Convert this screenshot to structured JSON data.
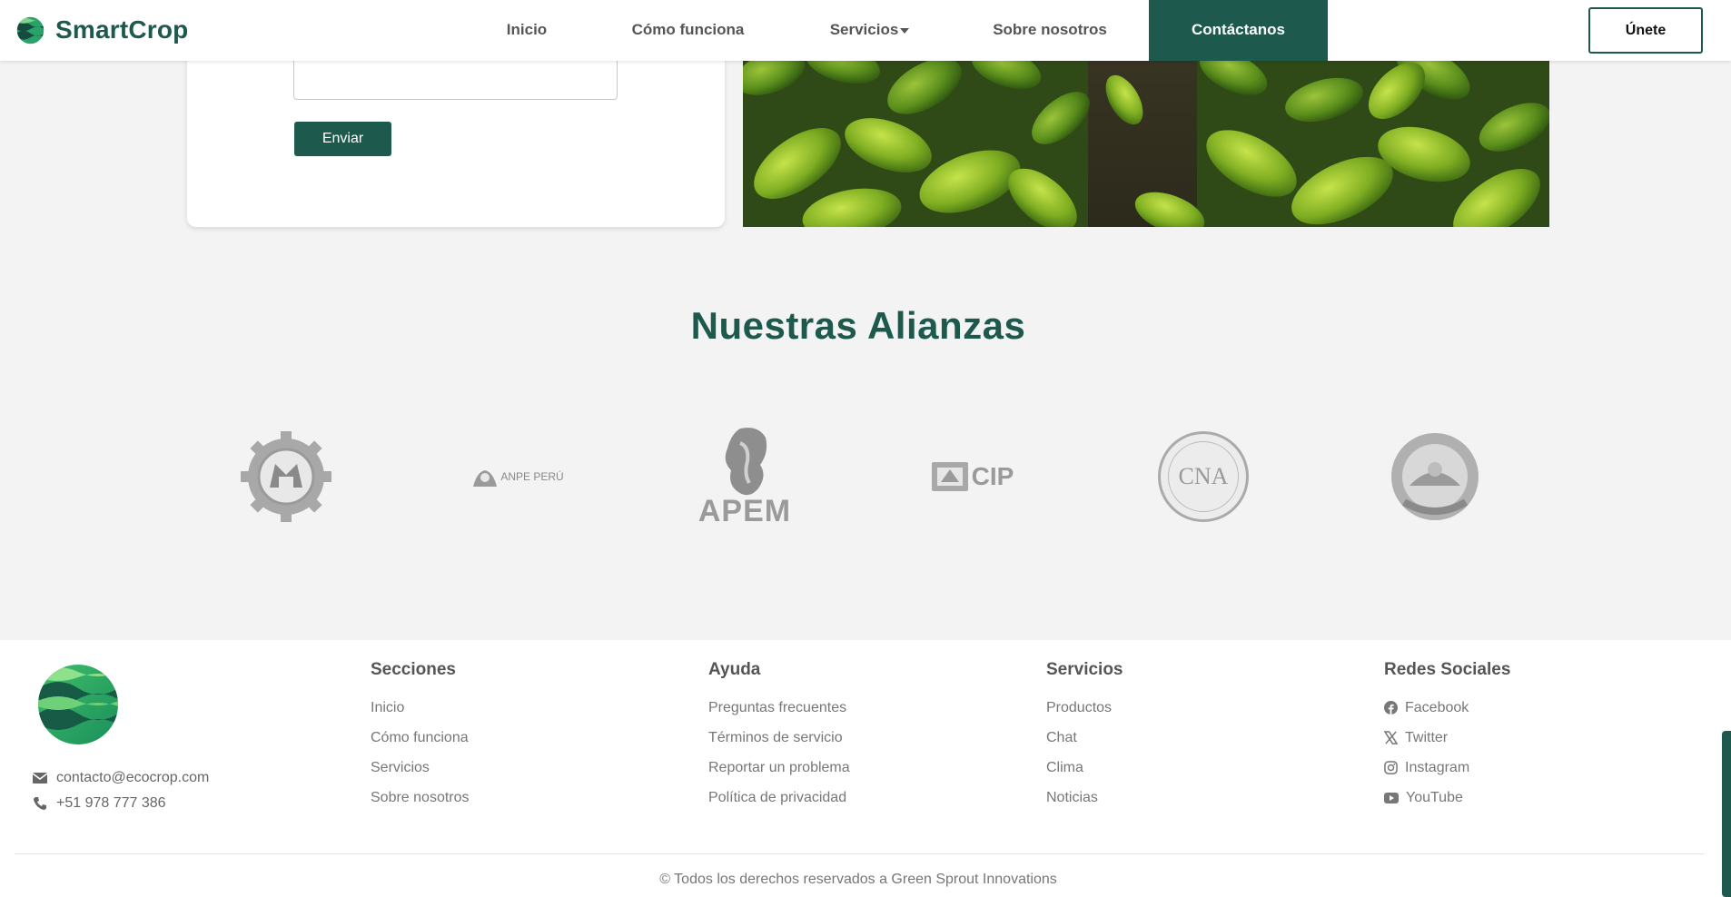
{
  "nav": {
    "brand": "SmartCrop",
    "links": [
      "Inicio",
      "Cómo funciona",
      "Servicios",
      "Sobre nosotros",
      "Contáctanos"
    ],
    "join_label": "Únete"
  },
  "form": {
    "send_label": "Enviar"
  },
  "alliances": {
    "title": "Nuestras Alianzas",
    "logos": [
      "ANPE PERÚ",
      "APEM",
      "CIP",
      "CNA"
    ]
  },
  "footer": {
    "email": "contacto@ecocrop.com",
    "phone": "+51 978 777 386",
    "columns": [
      {
        "title": "Secciones",
        "links": [
          "Inicio",
          "Cómo funciona",
          "Servicios",
          "Sobre nosotros"
        ]
      },
      {
        "title": "Ayuda",
        "links": [
          "Preguntas frecuentes",
          "Términos de servicio",
          "Reportar un problema",
          "Política de privacidad"
        ]
      },
      {
        "title": "Servicios",
        "links": [
          "Productos",
          "Chat",
          "Clima",
          "Noticias"
        ]
      },
      {
        "title": "Redes Sociales",
        "links": [
          "Facebook",
          "Twitter",
          "Instagram",
          "YouTube"
        ]
      }
    ],
    "copyright": "© Todos los derechos reservados a Green Sprout Innovations"
  },
  "colors": {
    "brand": "#1d5a4d",
    "background": "#f3f3f3"
  },
  "icons": [
    "brand-logo-icon",
    "mail-icon",
    "phone-icon",
    "facebook-icon",
    "x-twitter-icon",
    "instagram-icon",
    "youtube-icon"
  ]
}
